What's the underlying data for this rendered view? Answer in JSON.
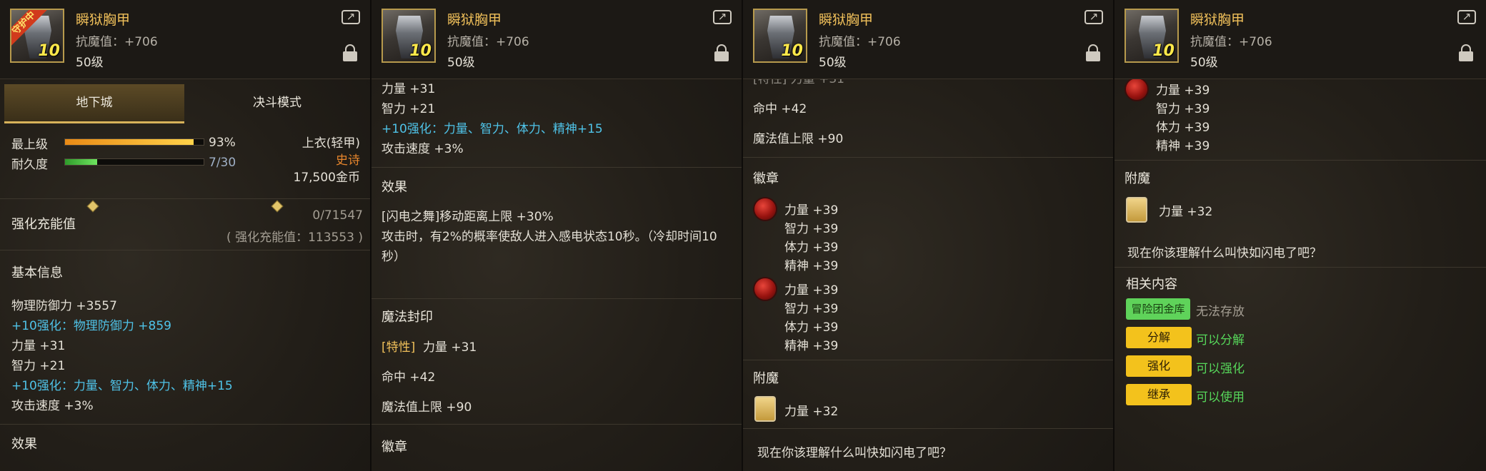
{
  "item": {
    "name": "瞬狱胸甲",
    "resist": "抗魔值：+706",
    "level": "50级",
    "badge": "守护中",
    "upgrade": "10"
  },
  "tabs": [
    "地下城",
    "决斗模式"
  ],
  "stats": {
    "grade_label": "最上级",
    "grade_percent": 93,
    "grade_text": "93%",
    "durability_label": "耐久度",
    "durability_value": 7,
    "durability_max": 30,
    "durability_text": "7/30",
    "slot": "上衣(轻甲)",
    "rarity": "史诗",
    "price": "17,500金币"
  },
  "charge": {
    "label": "强化充能值",
    "value": "0/71547",
    "note": "( 强化充能值：113553 )"
  },
  "basic": {
    "title": "基本信息",
    "phys_def": "物理防御力 +3557",
    "phys_def_bonus": "+10强化：物理防御力 +859",
    "str": "力量 +31",
    "int": "智力 +21",
    "all_bonus": "+10强化：力量、智力、体力、精神+15",
    "atk_speed": "攻击速度 +3%"
  },
  "effect": {
    "title": "效果",
    "line1": "[闪电之舞]移动距离上限 +30%",
    "line2": "攻击时，有2%的概率使敌人进入感电状态10秒。（冷却时间10秒）"
  },
  "seal": {
    "title": "魔法封印",
    "trait": "[特性]",
    "trait_value": "力量 +31",
    "hit": "命中 +42",
    "mp": "魔法值上限 +90",
    "partial": "[特性] 力量 +31"
  },
  "emblem": {
    "title": "徽章",
    "stats": [
      "力量 +39",
      "智力 +39",
      "体力 +39",
      "精神 +39"
    ]
  },
  "enchant": {
    "title": "附魔",
    "value": "力量 +32"
  },
  "flavor": "现在你该理解什么叫快如闪电了吧？",
  "related": {
    "title": "相关内容",
    "rows": [
      {
        "button": "冒险团金库",
        "status": "无法存放"
      },
      {
        "button": "分解",
        "status": "可以分解"
      },
      {
        "button": "强化",
        "status": "可以强化"
      },
      {
        "button": "继承",
        "status": "可以使用"
      }
    ]
  },
  "colors": {
    "accent": "#f0c05a",
    "bonus_blue": "#4fc3e8",
    "epic_orange": "#e6852c",
    "ok_green": "#56d65a",
    "button_yellow": "#f3c21c"
  }
}
